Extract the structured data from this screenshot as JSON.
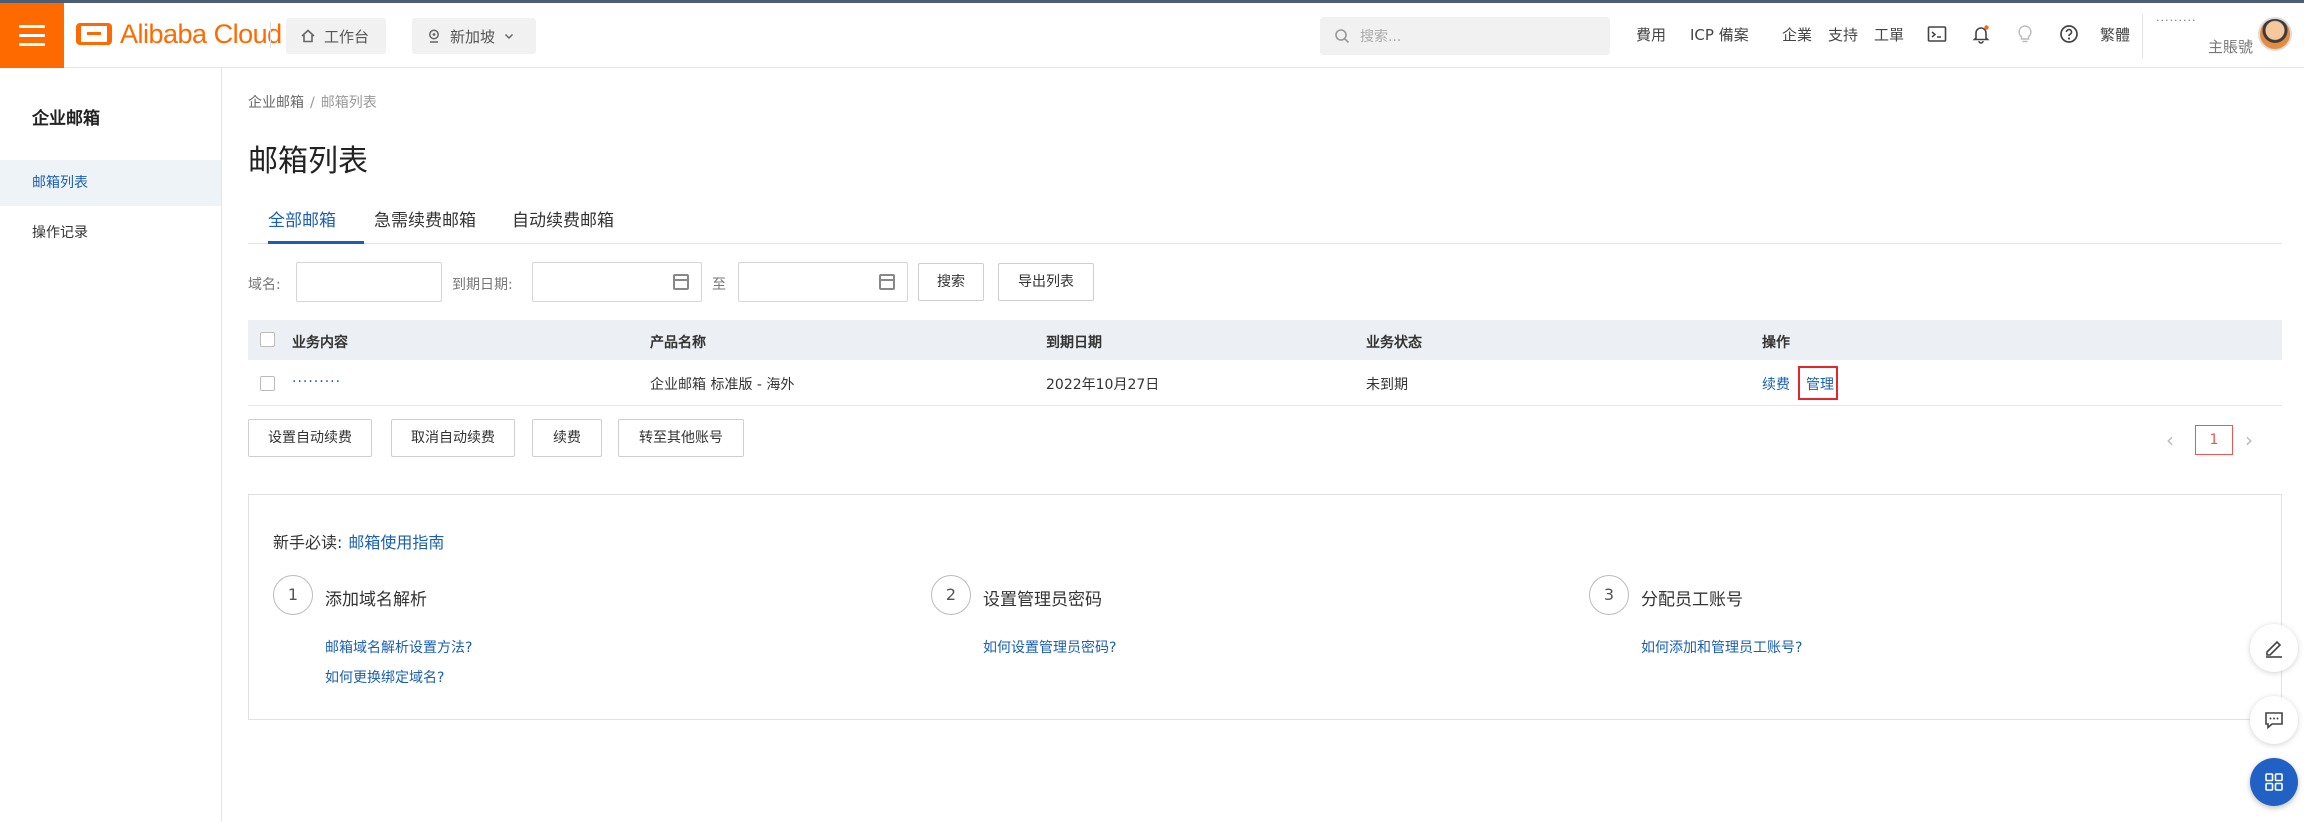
{
  "header": {
    "logo_text": "Alibaba Cloud",
    "workbench": "工作台",
    "region": "新加坡",
    "search_placeholder": "搜索...",
    "nav": [
      "費用",
      "ICP 備案",
      "企業",
      "支持",
      "工單"
    ],
    "lang": "繁體",
    "account_masked": "·········",
    "account_role": "主賬號"
  },
  "sidebar": {
    "title": "企业邮箱",
    "items": [
      {
        "label": "邮箱列表"
      },
      {
        "label": "操作记录"
      }
    ]
  },
  "breadcrumb": {
    "root": "企业邮箱",
    "sep": "/",
    "current": "邮箱列表"
  },
  "page_title": "邮箱列表",
  "tabs": [
    "全部邮箱",
    "急需续费邮箱",
    "自动续费邮箱"
  ],
  "filters": {
    "domain_label": "域名:",
    "expiry_label": "到期日期:",
    "to_label": "至",
    "search_button": "搜索",
    "export_button": "导出列表"
  },
  "table": {
    "headers": [
      "业务内容",
      "产品名称",
      "到期日期",
      "业务状态",
      "操作"
    ],
    "rows": [
      {
        "content": "·········",
        "product": "企业邮箱 标准版 - 海外",
        "expiry": "2022年10月27日",
        "status": "未到期",
        "action_renew": "续费",
        "action_manage": "管理"
      }
    ]
  },
  "bulk_actions": [
    "设置自动续费",
    "取消自动续费",
    "续费",
    "转至其他账号"
  ],
  "pagination": {
    "current": "1"
  },
  "guide": {
    "prefix": "新手必读:",
    "title_link": "邮箱使用指南",
    "steps": [
      {
        "num": "1",
        "label": "添加域名解析",
        "links": [
          "邮箱域名解析设置方法?",
          "如何更换绑定域名?"
        ]
      },
      {
        "num": "2",
        "label": "设置管理员密码",
        "links": [
          "如何设置管理员密码?"
        ]
      },
      {
        "num": "3",
        "label": "分配员工账号",
        "links": [
          "如何添加和管理员工账号?"
        ]
      }
    ]
  },
  "colors": {
    "brand": "#ff6a00",
    "link": "#1a5fb4",
    "highlight": "#e5242b"
  },
  "icons": {
    "menu": "hamburger-icon",
    "home": "home-icon",
    "location": "location-pin-icon",
    "search": "search-icon",
    "terminal": "terminal-icon",
    "bell": "bell-icon",
    "bulb": "lightbulb-icon",
    "help": "help-icon",
    "calendar": "calendar-icon",
    "edit": "edit-icon",
    "chat": "chat-icon",
    "apps": "apps-grid-icon"
  }
}
